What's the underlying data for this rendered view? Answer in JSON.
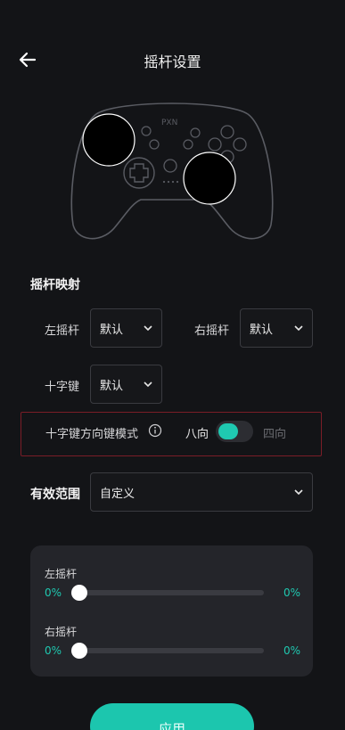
{
  "header": {
    "title": "摇杆设置",
    "back_icon": "arrow-left-icon"
  },
  "controller": {
    "logo_text": "PXN",
    "accent": "#5a5c63"
  },
  "mapping": {
    "section_title": "摇杆映射",
    "left_stick": {
      "label": "左摇杆",
      "value": "默认"
    },
    "right_stick": {
      "label": "右摇杆",
      "value": "默认"
    },
    "dpad": {
      "label": "十字键",
      "value": "默认"
    }
  },
  "dpad_mode": {
    "label": "十字键方向键模式",
    "option_eight": "八向",
    "option_four": "四向",
    "selected": "八向"
  },
  "effective_range": {
    "label": "有效范围",
    "value": "自定义",
    "left": {
      "label": "左摇杆",
      "min_text": "0%",
      "max_text": "0%",
      "value": 0
    },
    "right": {
      "label": "右摇杆",
      "min_text": "0%",
      "max_text": "0%",
      "value": 0
    }
  },
  "apply_label": "应用",
  "colors": {
    "accent": "#1fc9b1",
    "background": "#131417",
    "highlight_border": "#7a1d27"
  }
}
